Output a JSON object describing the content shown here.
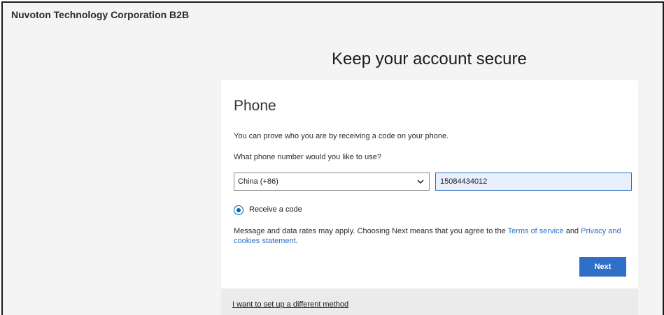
{
  "header": {
    "tenant_name": "Nuvoton Technology Corporation B2B"
  },
  "page": {
    "title": "Keep your account secure"
  },
  "card": {
    "heading": "Phone",
    "intro": "You can prove who you are by receiving a code on your phone.",
    "question": "What phone number would you like to use?",
    "country_select": {
      "selected": "China (+86)"
    },
    "phone_input": {
      "value": "15084434012"
    },
    "radio": {
      "label": "Receive a code",
      "checked": true
    },
    "disclaimer": {
      "prefix": "Message and data rates may apply. Choosing Next means that you agree to the ",
      "terms_link": "Terms of service",
      "middle": " and ",
      "privacy_link": "Privacy and cookies statement",
      "suffix": "."
    },
    "next_label": "Next"
  },
  "footer": {
    "different_method_link": "I want to set up a different method"
  },
  "colors": {
    "accent": "#2f6fc7",
    "radio": "#0067b8",
    "page_background": "#f4f4f4",
    "card_background": "#ffffff",
    "footer_background": "#ebebeb"
  }
}
